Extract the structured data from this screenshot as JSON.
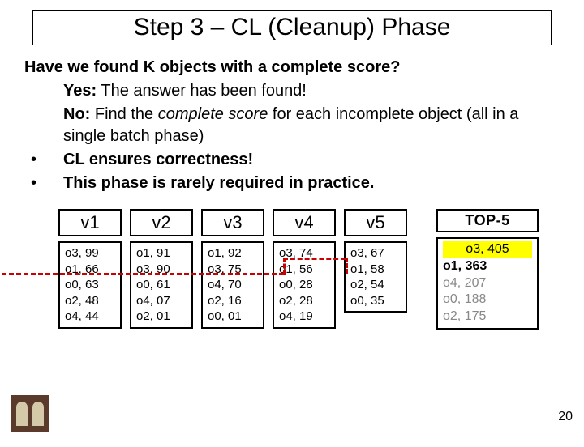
{
  "title": "Step 3 – CL (Cleanup) Phase",
  "question": "Have we found K objects with a complete score?",
  "yes": {
    "label": "Yes:",
    "text": "The answer has been found!"
  },
  "no": {
    "label": "No:",
    "text_a": "Find the ",
    "text_i": "complete score",
    "text_b": " for each incomplete object (all in a single batch phase)"
  },
  "bullets": [
    "CL ensures correctness!",
    "This phase is rarely required in practice."
  ],
  "columns": [
    {
      "head": "v1",
      "rows": [
        "o3, 99",
        "o1, 66",
        "o0, 63",
        "o2, 48",
        "o4, 44"
      ]
    },
    {
      "head": "v2",
      "rows": [
        "o1, 91",
        "o3, 90",
        "o0, 61",
        "o4, 07",
        "o2, 01"
      ]
    },
    {
      "head": "v3",
      "rows": [
        "o1, 92",
        "o3, 75",
        "o4, 70",
        "o2, 16",
        "o0, 01"
      ]
    },
    {
      "head": "v4",
      "rows": [
        "o3, 74",
        "o1, 56",
        "o0, 28",
        "o2, 28",
        "o4, 19"
      ]
    },
    {
      "head": "v5",
      "rows": [
        "o3, 67",
        "o1, 58",
        "o2, 54",
        "o0, 35"
      ]
    }
  ],
  "top5": {
    "head": "TOP-5",
    "rows": [
      {
        "text": "o3, 405",
        "style": "highlight"
      },
      {
        "text": "o1, 363",
        "style": "bold"
      },
      {
        "text": "o4, 207",
        "style": "gray"
      },
      {
        "text": "o0, 188",
        "style": "gray"
      },
      {
        "text": "o2, 175",
        "style": "gray"
      }
    ]
  },
  "page": "20"
}
